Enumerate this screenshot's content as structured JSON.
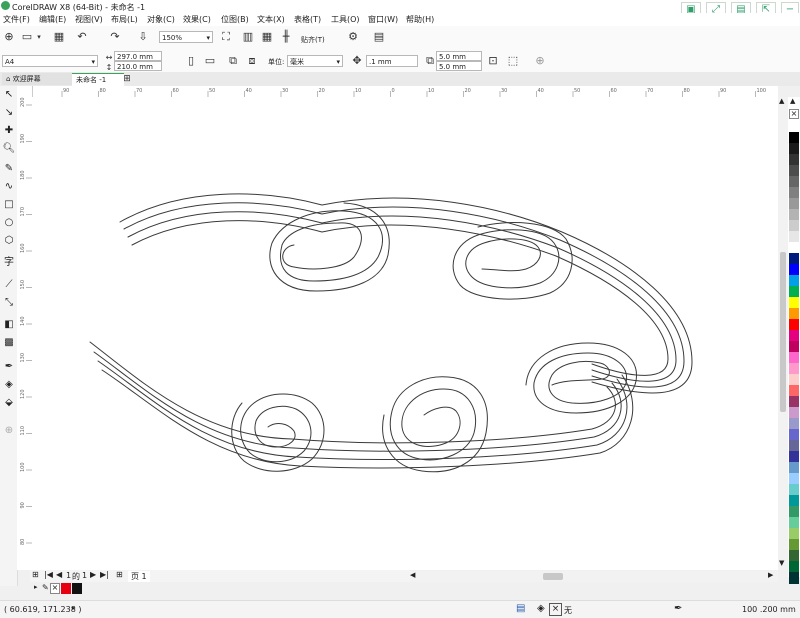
{
  "app": {
    "title": "CorelDRAW X8 (64-Bit) - 未命名 -1"
  },
  "menu": [
    "文件(F)",
    "编辑(E)",
    "视图(V)",
    "布局(L)",
    "对象(C)",
    "效果(C)",
    "位图(B)",
    "文本(X)",
    "表格(T)",
    "工具(O)",
    "窗口(W)",
    "帮助(H)"
  ],
  "toolbar": {
    "zoom": "150%",
    "snap_label": "贴齐(T)"
  },
  "properties": {
    "page_size": "A4",
    "width": "297.0 mm",
    "height": "210.0 mm",
    "units_label": "单位:",
    "units_value": "毫米",
    "nudge": ".1 mm",
    "dup_x": "5.0 mm",
    "dup_y": "5.0 mm"
  },
  "tabs": {
    "welcome": "欢迎屏幕",
    "document": "未命名 -1"
  },
  "ruler": {
    "h_ticks": [
      "90",
      "80",
      "70",
      "60",
      "50",
      "40",
      "30",
      "20",
      "10",
      "0",
      "10",
      "20",
      "30",
      "40",
      "50",
      "60",
      "70",
      "80",
      "90",
      "100",
      "110",
      "120",
      "130",
      "140",
      "150",
      "160",
      "170",
      "180",
      "190",
      "200",
      "210",
      "220",
      "230",
      "240",
      "250",
      "260",
      "270",
      "280",
      "290",
      "300"
    ],
    "v_ticks": [
      "200",
      "190",
      "180",
      "170",
      "160",
      "150",
      "140",
      "130",
      "120",
      "110",
      "100",
      "90",
      "80",
      "70",
      "60",
      "50",
      "40",
      "30",
      "20",
      "10",
      "0"
    ]
  },
  "page_nav": {
    "current": "1",
    "of_label": "的",
    "total": "1",
    "page_tab": "页 1"
  },
  "palette": {
    "colors": [
      "#ffffff",
      "#000000",
      "#1a1a1a",
      "#333333",
      "#4d4d4d",
      "#666666",
      "#808080",
      "#999999",
      "#b3b3b3",
      "#cccccc",
      "#e6e6e6",
      "#ffffff",
      "#001a80",
      "#0000ff",
      "#00a0e9",
      "#00b050",
      "#ffff00",
      "#ff9900",
      "#ff0000",
      "#e4007f",
      "#c00060",
      "#ff66cc",
      "#ff99cc",
      "#ffcccc",
      "#ff6666",
      "#993366",
      "#cc99cc",
      "#9999cc",
      "#6666cc",
      "#666699",
      "#333399",
      "#6699cc",
      "#99ccff",
      "#66cccc",
      "#009999",
      "#339966",
      "#66cc99",
      "#99cc66",
      "#669933",
      "#336633",
      "#006633",
      "#003333"
    ]
  },
  "status": {
    "coords": "( 60.619, 171.238 )",
    "fill_label": "无",
    "outline_info": "100 .200 mm"
  }
}
